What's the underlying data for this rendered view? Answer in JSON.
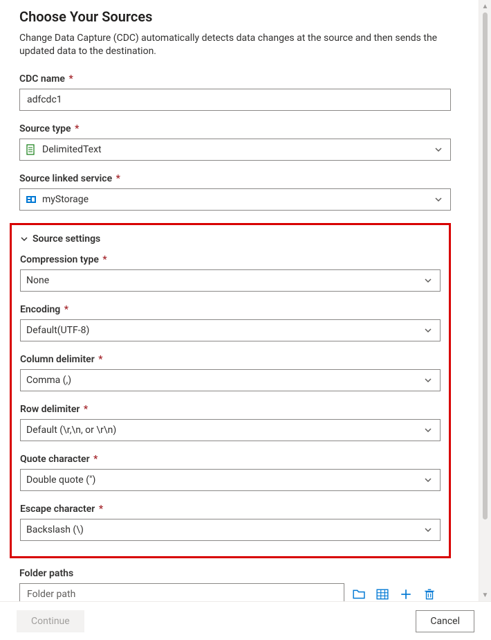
{
  "header": {
    "title": "Choose Your Sources",
    "description": "Change Data Capture (CDC) automatically detects data changes at the source and then sends the updated data to the destination."
  },
  "fields": {
    "cdc_name": {
      "label": "CDC name",
      "value": "adfcdc1"
    },
    "source_type": {
      "label": "Source type",
      "value": "DelimitedText"
    },
    "linked_service": {
      "label": "Source linked service",
      "value": "myStorage"
    }
  },
  "source_settings": {
    "section_label": "Source settings",
    "compression_type": {
      "label": "Compression type",
      "value": "None"
    },
    "encoding": {
      "label": "Encoding",
      "value": "Default(UTF-8)"
    },
    "column_delimiter": {
      "label": "Column delimiter",
      "value": "Comma (,)"
    },
    "row_delimiter": {
      "label": "Row delimiter",
      "value": "Default (\\r,\\n, or \\r\\n)"
    },
    "quote_character": {
      "label": "Quote character",
      "value": "Double quote (\")"
    },
    "escape_character": {
      "label": "Escape character",
      "value": "Backslash (\\)"
    }
  },
  "folder_paths": {
    "label": "Folder paths",
    "placeholder": "Folder path"
  },
  "footer": {
    "continue_label": "Continue",
    "cancel_label": "Cancel"
  },
  "colors": {
    "accent": "#0078d4",
    "required": "#a4262c",
    "highlight_border": "#d80000"
  }
}
